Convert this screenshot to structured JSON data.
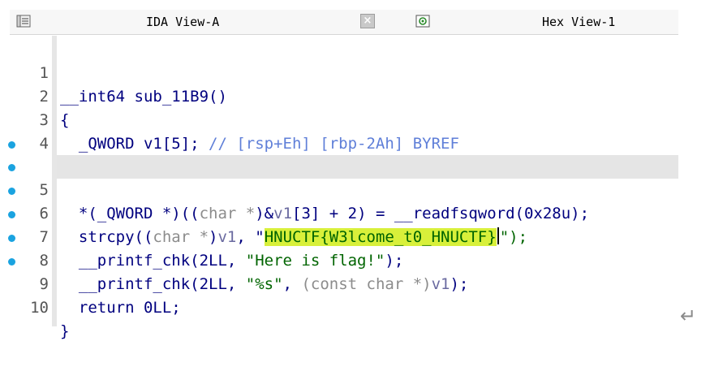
{
  "tabs": [
    {
      "title": "IDA View-A",
      "icon": "ida-view-icon",
      "closable": true
    },
    {
      "title": "Hex View-1",
      "icon": "hex-view-icon",
      "closable": false
    }
  ],
  "close_glyph": "×",
  "code_lines": [
    {
      "n": "1",
      "bp": false
    },
    {
      "n": "2",
      "bp": false
    },
    {
      "n": "3",
      "bp": false
    },
    {
      "n": "4",
      "bp": false
    },
    {
      "n": "5",
      "bp": true
    },
    {
      "n": "6",
      "bp": true
    },
    {
      "n": "7",
      "bp": true
    },
    {
      "n": "8",
      "bp": true
    },
    {
      "n": "9",
      "bp": true
    },
    {
      "n": "10",
      "bp": true
    }
  ],
  "code": {
    "l1": "__int64 sub_11B9()",
    "l2": "{",
    "l3_decl": "  _QWORD v1[5]; ",
    "l3_cmt": "// [rsp+Eh] [rbp-2Ah] BYREF",
    "l5_a": "  *(_QWORD *)((",
    "l5_b": "char *",
    "l5_c": ")&",
    "l5_d": "v1",
    "l5_e": "[3] + 2) = __readfsqword(0x28u);",
    "l6_a": "  strcpy((",
    "l6_b": "char *",
    "l6_c": ")",
    "l6_d": "v1",
    "l6_e": ", \"",
    "l6_flag": "HNUCTF{W3lcome_t0_HNUCTF}",
    "l6_f": "\");",
    "l7_a": "  __printf_chk(2LL, ",
    "l7_str": "\"Here is flag!\"",
    "l7_b": ");",
    "l8_a": "  __printf_chk(2LL, ",
    "l8_str": "\"%s\"",
    "l8_b": ", ",
    "l8_c": "(const char *)",
    "l8_d": "v1",
    "l8_e": ");",
    "l9": "  return 0LL;",
    "l10": "}"
  },
  "enter_glyph": "↵",
  "colors": {
    "breakpoint": "#1aa3e0",
    "highlight": "#d8f03a",
    "keyword": "#00007f",
    "comment": "#5f7fd8"
  }
}
